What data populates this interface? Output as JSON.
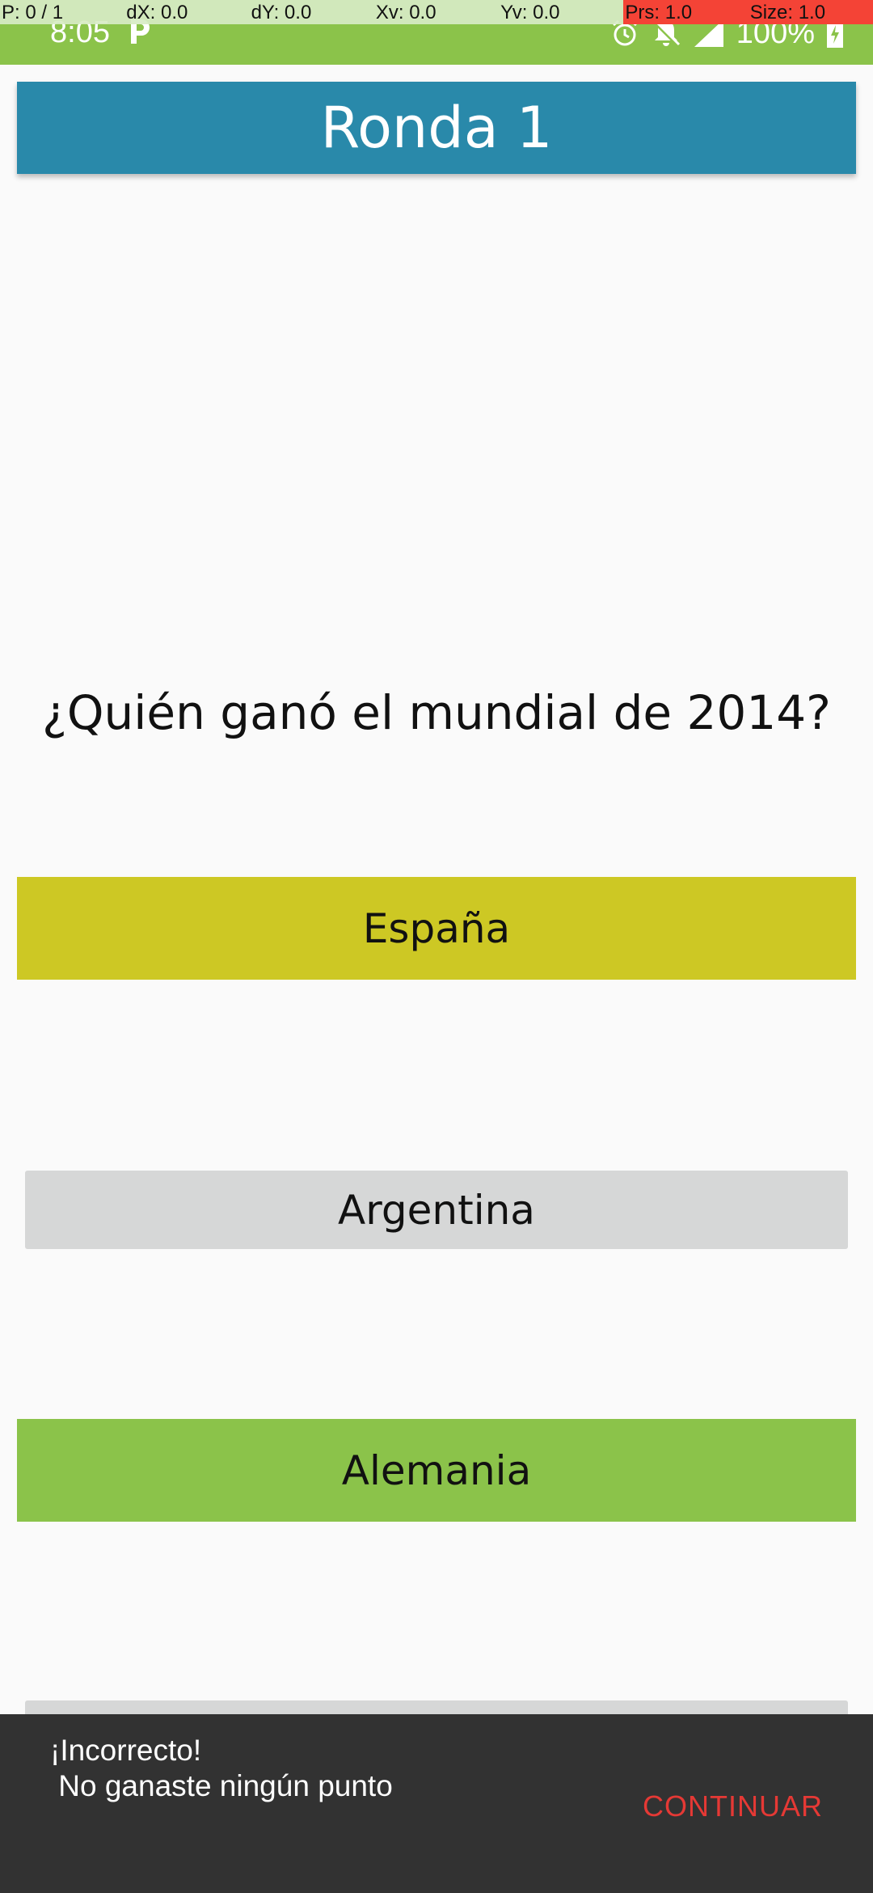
{
  "status_bar": {
    "time": "8:05",
    "battery": "100%",
    "background_color": "#8bc34a",
    "icons": [
      "p-notification-icon",
      "alarm-icon",
      "notifications-muted-icon",
      "signal-icon",
      "battery-charging-icon"
    ]
  },
  "pointer_overlay": {
    "cells": [
      "P: 0 / 1",
      "dX: 0.0",
      "dY: 0.0",
      "Xv: 0.0",
      "Yv: 0.0",
      "Prs: 1.0",
      "Size: 1.0"
    ]
  },
  "header": {
    "title": "Ronda 1",
    "color": "#2989aa"
  },
  "question": {
    "text": "¿Quién ganó el mundial de 2014?"
  },
  "answers": [
    {
      "label": "España",
      "state": "selected-wrong",
      "color": "#cdc824"
    },
    {
      "label": "Argentina",
      "state": "default",
      "color": "#d6d7d7"
    },
    {
      "label": "Alemania",
      "state": "correct",
      "color": "#8bc34a"
    },
    {
      "label": "",
      "state": "default",
      "color": "#d6d7d7"
    }
  ],
  "snackbar": {
    "message": "¡Incorrecto!\n No ganaste ningún punto",
    "action": "CONTINUAR",
    "action_color": "#e53935",
    "background_color": "#323232"
  }
}
